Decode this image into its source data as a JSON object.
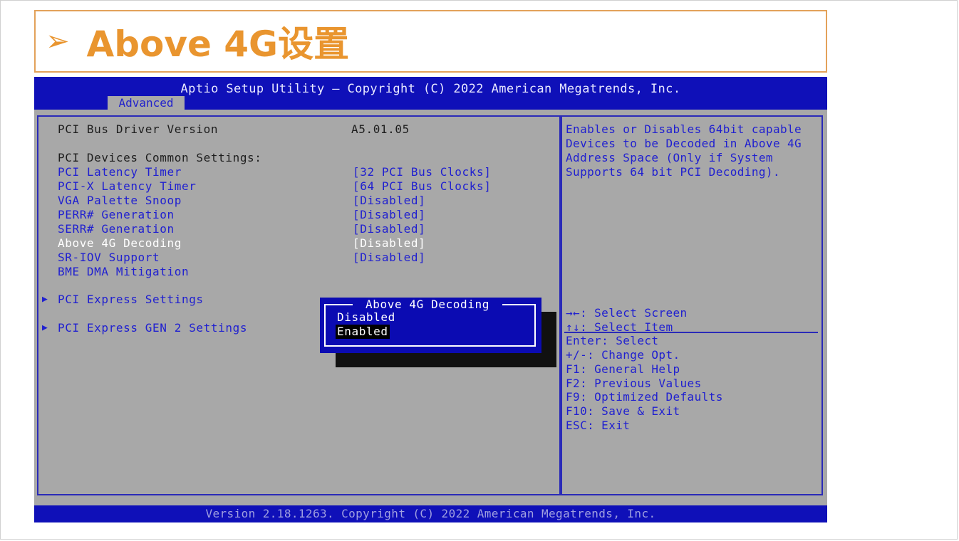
{
  "slide": {
    "arrow": "➢",
    "title": "Above 4G设置"
  },
  "bios": {
    "header_title": "Aptio Setup Utility – Copyright (C) 2022 American Megatrends, Inc.",
    "active_tab": "Advanced",
    "footer": "Version 2.18.1263. Copyright (C) 2022 American Megatrends, Inc.",
    "rows": {
      "bus_driver_label": "PCI Bus Driver Version",
      "bus_driver_value": "A5.01.05",
      "common_settings": "PCI Devices Common Settings:",
      "latency_label": "PCI Latency Timer",
      "latency_value": "[32 PCI Bus Clocks]",
      "pcix_label": "PCI-X Latency Timer",
      "pcix_value": "[64 PCI Bus Clocks]",
      "vga_label": "VGA Palette Snoop",
      "vga_value": "[Disabled]",
      "perr_label": "PERR# Generation",
      "perr_value": "[Disabled]",
      "serr_label": "SERR# Generation",
      "serr_value": "[Disabled]",
      "above4g_label": "Above 4G Decoding",
      "above4g_value": "[Disabled]",
      "sriov_label": "SR-IOV Support",
      "sriov_value": "[Disabled]",
      "bme_label": "BME DMA Mitigation",
      "pcie_settings": "PCI Express Settings",
      "pcie_gen2": "PCI Express GEN 2 Settings"
    },
    "help_text": "Enables or Disables 64bit capable Devices to be Decoded in Above 4G Address Space (Only if System Supports 64 bit PCI Decoding).",
    "keys": [
      "→←: Select Screen",
      "↑↓: Select Item",
      "Enter: Select",
      "+/-: Change Opt.",
      "F1: General Help",
      "F2: Previous Values",
      "F9: Optimized Defaults",
      "F10: Save & Exit",
      "ESC: Exit"
    ],
    "popup": {
      "title": "Above 4G Decoding",
      "options": [
        "Disabled",
        "Enabled"
      ],
      "selected": "Enabled"
    }
  }
}
